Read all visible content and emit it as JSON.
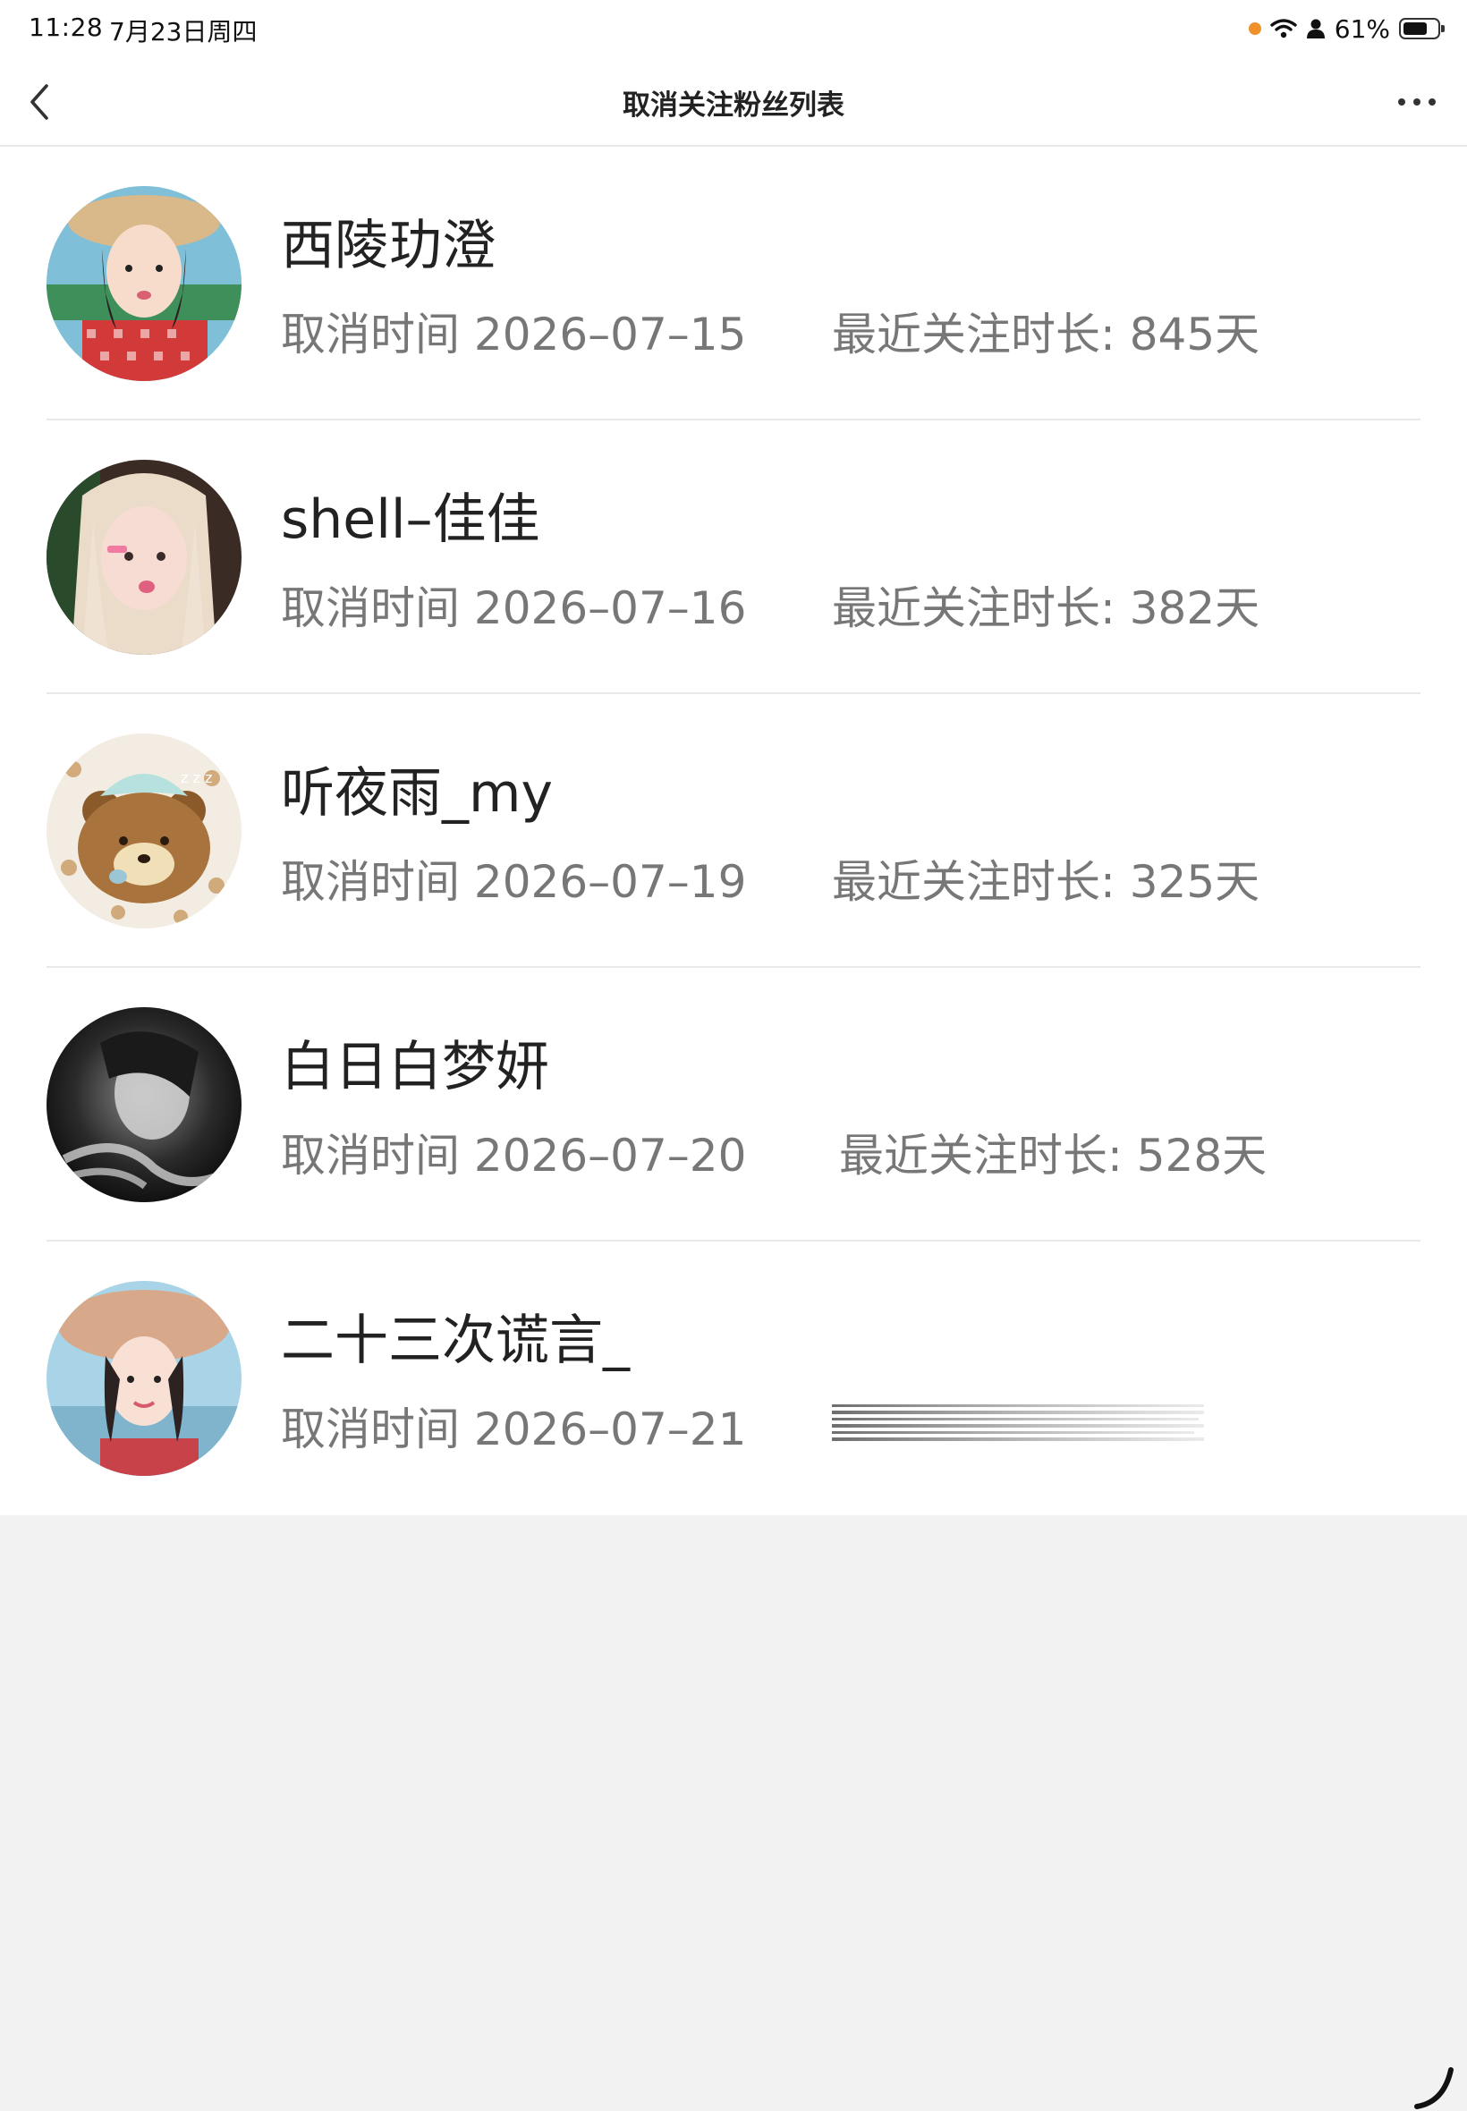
{
  "status_bar": {
    "time": "11:28",
    "date": "7月23日周四",
    "battery": "61%",
    "battery_level": 0.61,
    "recording_dot_color": "#f0902a"
  },
  "nav": {
    "title": "取消关注粉丝列表",
    "back_icon": "chevron-left-icon",
    "more_icon": "more-horizontal-icon"
  },
  "list": {
    "items": [
      {
        "name": "西陵玏澄",
        "cancel_time": "取消时间 2026–07–15",
        "follow_duration": "最近关注时长: 845天",
        "avatar": "avatar-photo"
      },
      {
        "name": "shell–佳佳",
        "cancel_time": "取消时间 2026–07–16",
        "follow_duration": "最近关注时长: 382天",
        "avatar": "avatar-photo"
      },
      {
        "name": "听夜雨_my",
        "cancel_time": "取消时间 2026–07–19",
        "follow_duration": "最近关注时长: 325天",
        "avatar": "avatar-bear"
      },
      {
        "name": "白日白梦妍",
        "cancel_time": "取消时间 2026–07–20",
        "follow_duration": "最近关注时长: 528天",
        "avatar": "avatar-photo"
      },
      {
        "name": "二十三次谎言_",
        "cancel_time": "取消时间 2026–07–21",
        "follow_duration": "",
        "avatar": "avatar-photo"
      }
    ]
  },
  "colors": {
    "page_background": "#f2f2f2",
    "list_background": "#ffffff",
    "primary_text": "#222222",
    "secondary_text": "#777777",
    "divider": "#e9e9e9"
  }
}
